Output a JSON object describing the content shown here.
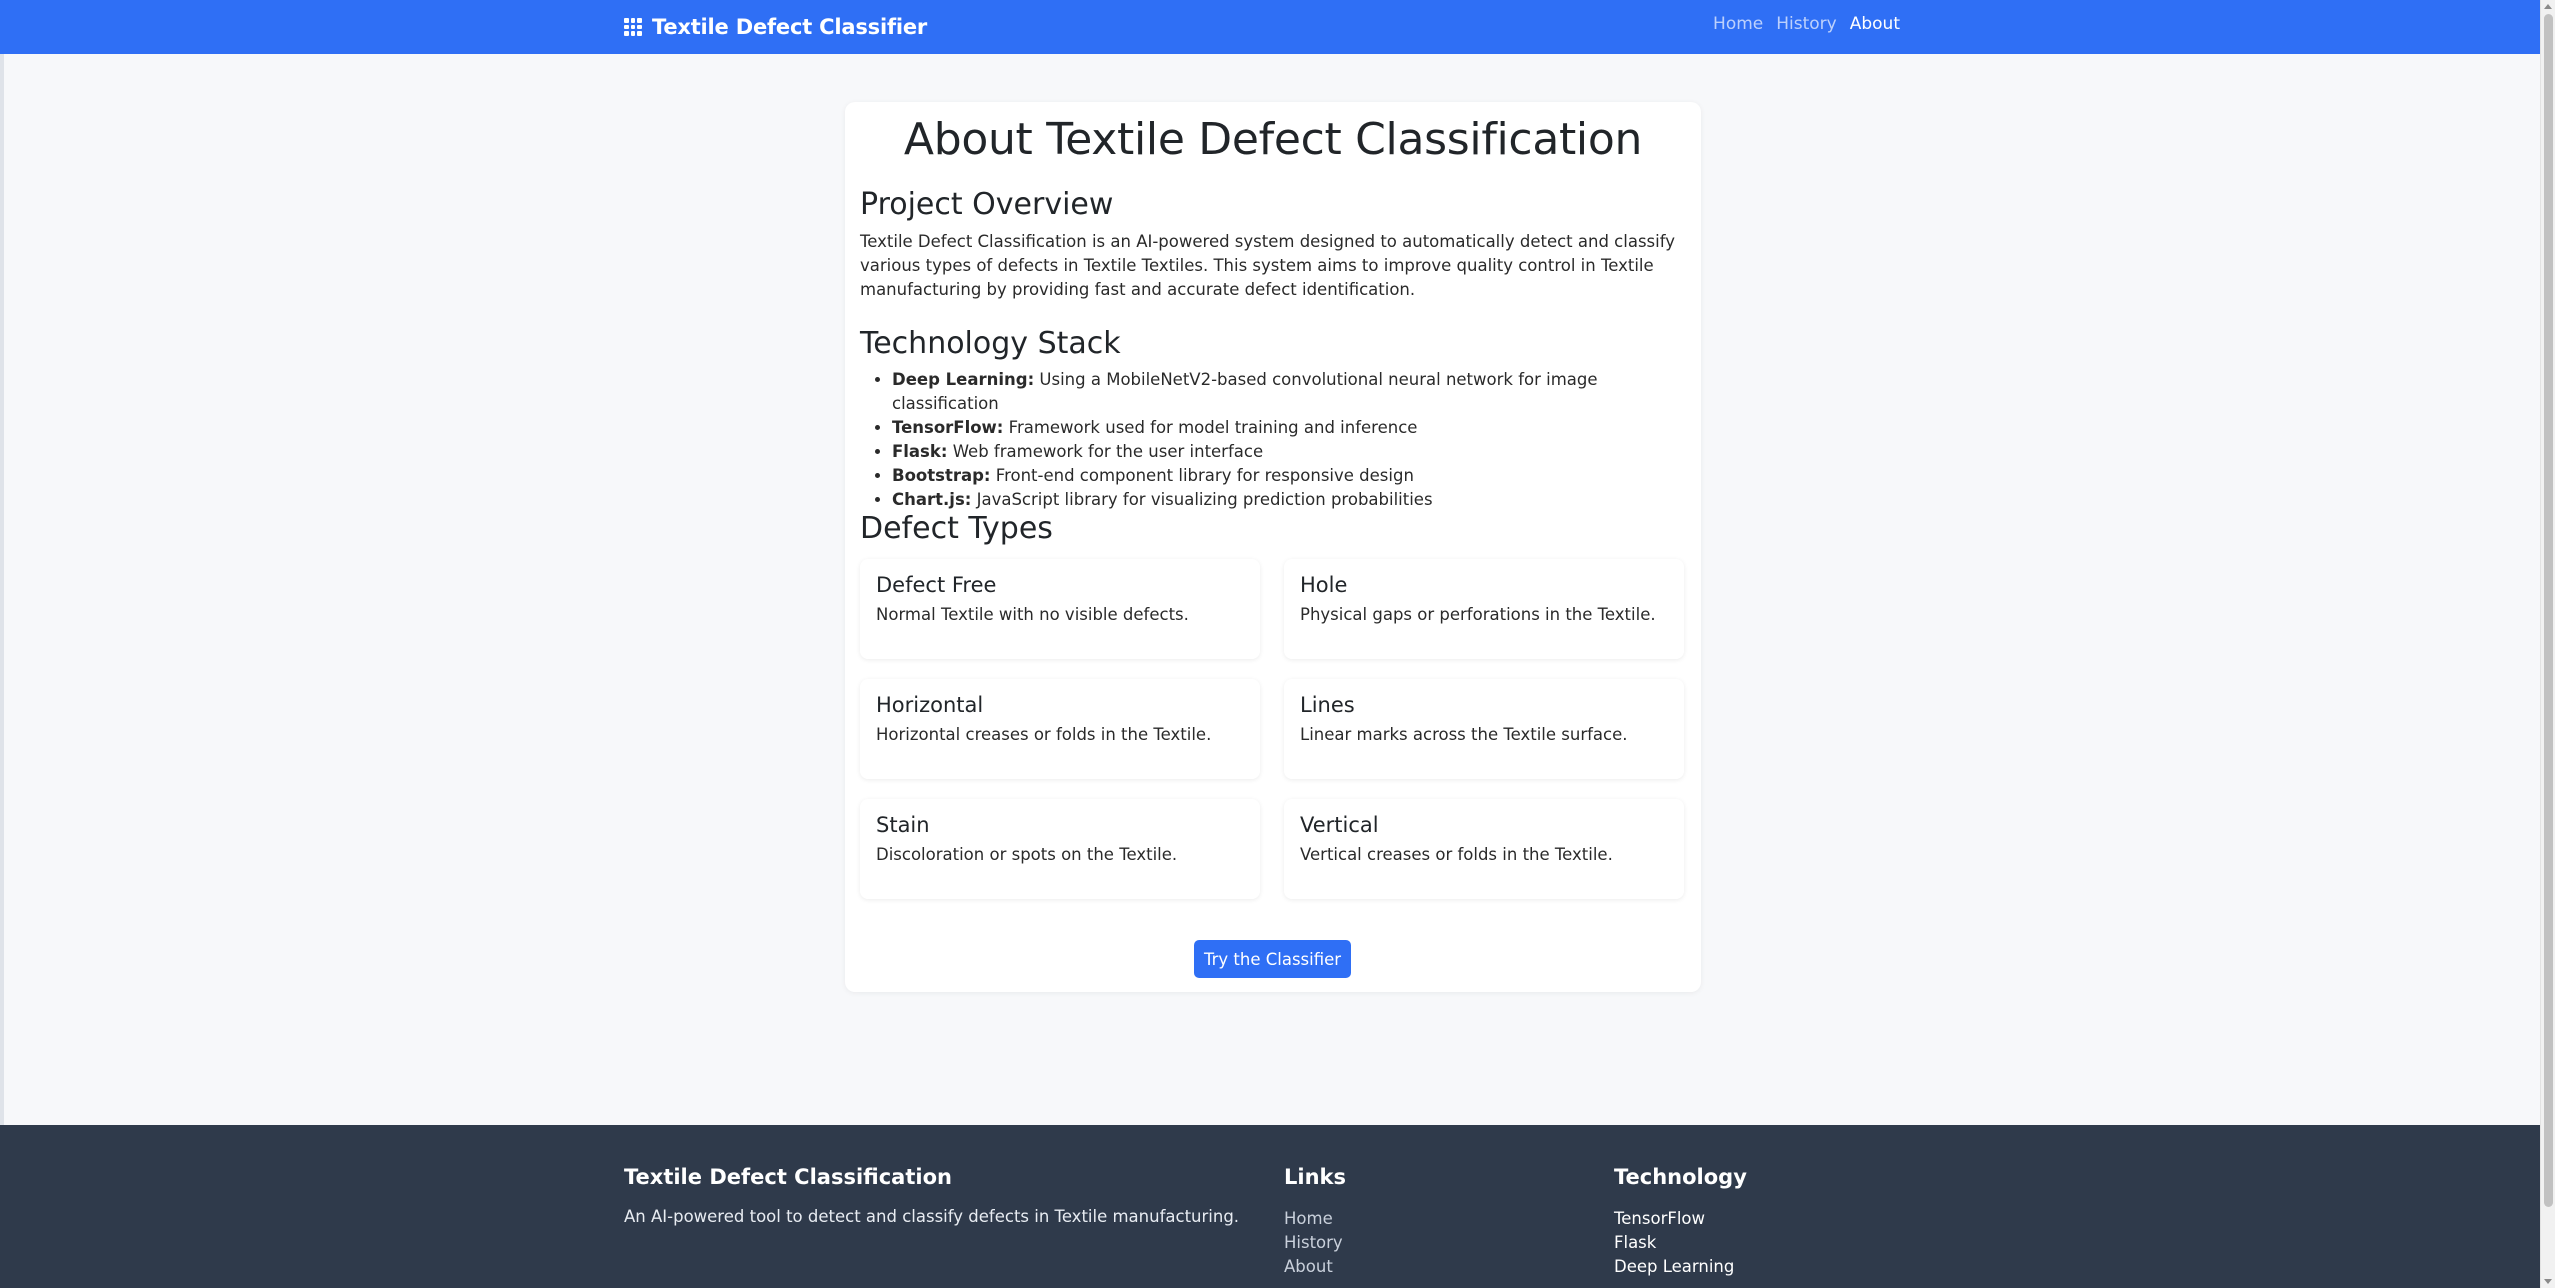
{
  "navbar": {
    "brand": "Textile Defect Classifier",
    "brand_icon": "grid-icon",
    "links": [
      {
        "label": "Home",
        "active": false
      },
      {
        "label": "History",
        "active": false
      },
      {
        "label": "About",
        "active": true
      }
    ]
  },
  "main": {
    "title": "About Textile Defect Classification",
    "overview": {
      "heading": "Project Overview",
      "text": "Textile Defect Classification is an AI-powered system designed to automatically detect and classify various types of defects in Textile Textiles. This system aims to improve quality control in Textile manufacturing by providing fast and accurate defect identification."
    },
    "tech_stack": {
      "heading": "Technology Stack",
      "items": [
        {
          "name": "Deep Learning:",
          "desc": " Using a MobileNetV2-based convolutional neural network for image classification"
        },
        {
          "name": "TensorFlow:",
          "desc": " Framework used for model training and inference"
        },
        {
          "name": "Flask:",
          "desc": " Web framework for the user interface"
        },
        {
          "name": "Bootstrap:",
          "desc": " Front-end component library for responsive design"
        },
        {
          "name": "Chart.js:",
          "desc": " JavaScript library for visualizing prediction probabilities"
        }
      ]
    },
    "defects": {
      "heading": "Defect Types",
      "items": [
        {
          "title": "Defect Free",
          "desc": "Normal Textile with no visible defects."
        },
        {
          "title": "Hole",
          "desc": "Physical gaps or perforations in the Textile."
        },
        {
          "title": "Horizontal",
          "desc": "Horizontal creases or folds in the Textile."
        },
        {
          "title": "Lines",
          "desc": "Linear marks across the Textile surface."
        },
        {
          "title": "Stain",
          "desc": "Discoloration or spots on the Textile."
        },
        {
          "title": "Vertical",
          "desc": "Vertical creases or folds in the Textile."
        }
      ]
    },
    "cta_label": "Try the Classifier"
  },
  "footer": {
    "about": {
      "title": "Textile Defect Classification",
      "text": "An AI-powered tool to detect and classify defects in Textile manufacturing."
    },
    "links": {
      "title": "Links",
      "items": [
        "Home",
        "History",
        "About"
      ]
    },
    "technology": {
      "title": "Technology",
      "items": [
        "TensorFlow",
        "Flask",
        "Deep Learning"
      ]
    }
  },
  "colors": {
    "primary": "#2f6ff5",
    "footer_bg": "#2f3a4b",
    "page_bg": "#f7f8fa"
  }
}
